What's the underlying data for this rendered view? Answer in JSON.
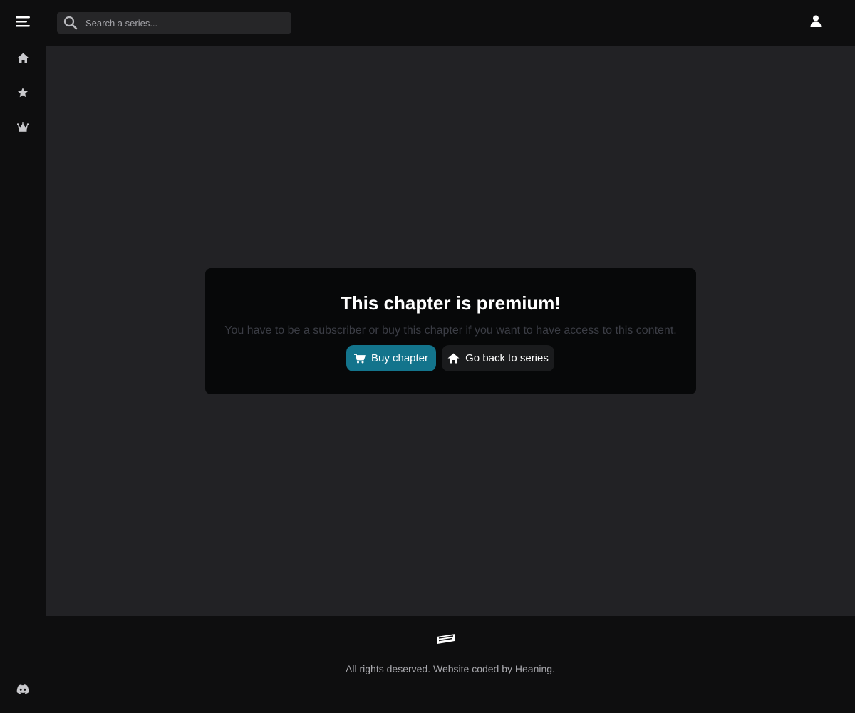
{
  "header": {
    "search_placeholder": "Search a series...",
    "icons": {
      "menu": "menu-icon",
      "search": "search-icon",
      "user": "user-icon"
    }
  },
  "sidebar": {
    "items": [
      {
        "icon": "home-icon"
      },
      {
        "icon": "star-icon"
      },
      {
        "icon": "crown-icon"
      }
    ],
    "bottom_icon": "discord-icon"
  },
  "premium_card": {
    "title": "This chapter is premium!",
    "message": "You have to be a subscriber or buy this chapter if you want to have access to this content.",
    "buy_label": "Buy chapter",
    "back_label": "Go back to series",
    "accent_color": "#13748c"
  },
  "footer": {
    "copyright": "All rights deserved. Website coded by Heaning."
  }
}
